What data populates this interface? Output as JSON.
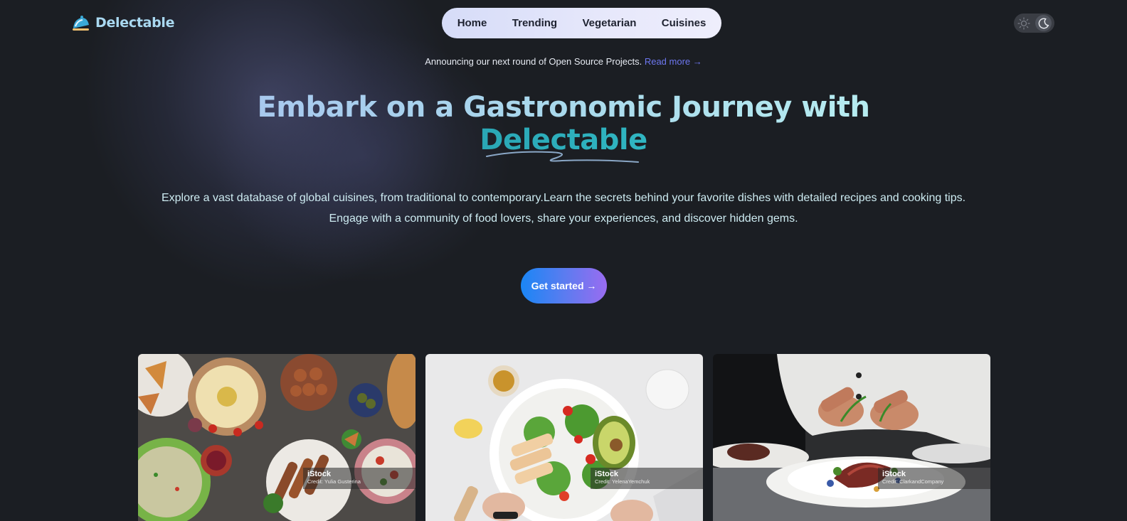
{
  "brand": {
    "name": "Delectable",
    "logo_icon": "food-dome-icon"
  },
  "nav": {
    "items": [
      "Home",
      "Trending",
      "Vegetarian",
      "Cuisines"
    ]
  },
  "theme_toggle": {
    "light_icon": "sun-icon",
    "dark_icon": "moon-icon",
    "state": "dark"
  },
  "announcement": {
    "text": "Announcing our next round of Open Source Projects.",
    "link": "Read more →"
  },
  "hero": {
    "title_line1": "Embark on a Gastronomic Journey with",
    "title_line2": "Delectable",
    "subtitle_line1": "Explore a vast database of global cuisines, from traditional to contemporary.Learn the secrets behind your favorite dishes with detailed recipes and cooking tips.",
    "subtitle_line2": "Engage with a community of food lovers, share your experiences, and discover hidden gems.",
    "cta_label": "Get started →"
  },
  "cards": [
    {
      "source": "iStock",
      "credit": "Credit: Yulia Gusterina",
      "subject": "mediterranean-platter"
    },
    {
      "source": "iStock",
      "credit": "Credit: YelenaYemchuk",
      "subject": "chicken-salad-bowl"
    },
    {
      "source": "iStock",
      "credit": "Credit: ClarkandCompany",
      "subject": "chef-plating"
    }
  ],
  "colors": {
    "background": "#1b1e23",
    "accent_teal": "#2aa7b5",
    "link": "#6d77f0",
    "cta_start": "#1a86f5",
    "cta_end": "#9a6cf0"
  }
}
